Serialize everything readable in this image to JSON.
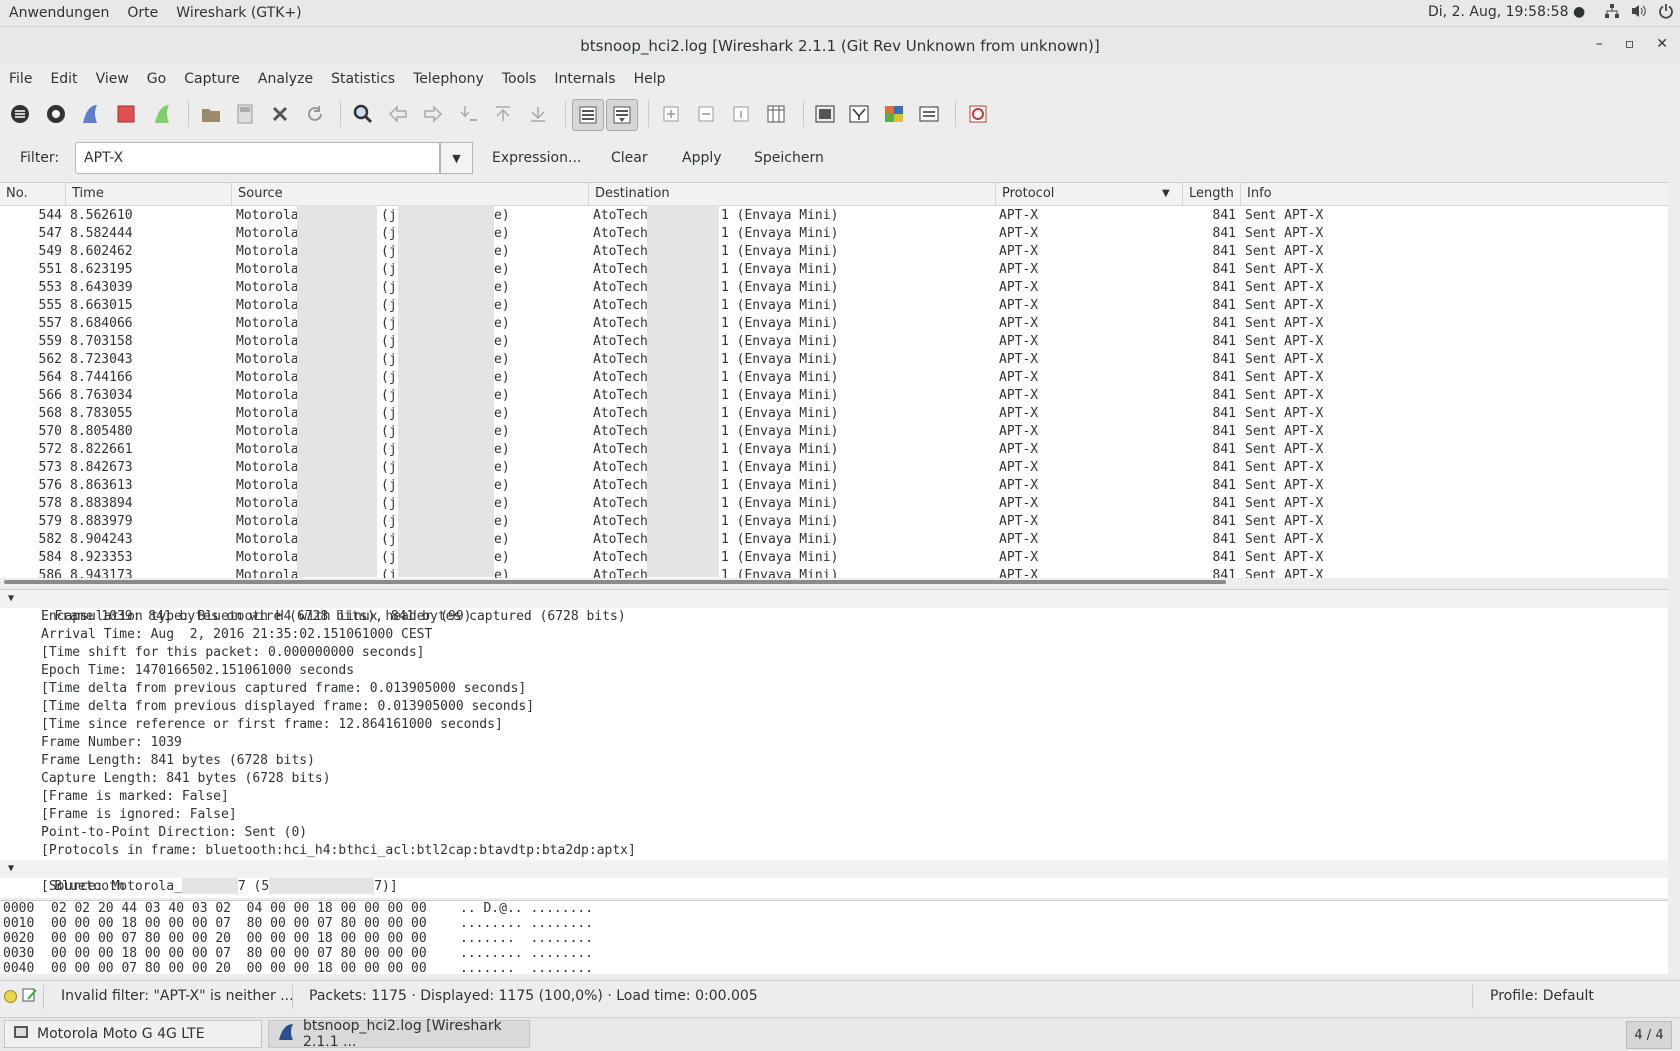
{
  "topbar": {
    "apps": "Anwendungen",
    "places": "Orte",
    "active_app": "Wireshark (GTK+)",
    "clock": "Di,  2. Aug, 19:58:58",
    "network_icon": "network-icon",
    "volume_icon": "volume-icon",
    "power_icon": "power-icon"
  },
  "window": {
    "title": "btsnoop_hci2.log [Wireshark 2.1.1 (Git Rev Unknown from unknown)]",
    "minimize": "–",
    "maximize": "▫",
    "close": "✕"
  },
  "menubar": [
    "File",
    "Edit",
    "View",
    "Go",
    "Capture",
    "Analyze",
    "Statistics",
    "Telephony",
    "Tools",
    "Internals",
    "Help"
  ],
  "toolbar": {
    "icons": [
      "interfaces-icon",
      "options-icon",
      "start-capture-icon",
      "stop-capture-icon",
      "restart-capture-icon",
      "open-file-icon",
      "save-file-icon",
      "close-file-icon",
      "reload-icon",
      "find-packet-icon",
      "go-back-icon",
      "go-forward-icon",
      "go-to-packet-icon",
      "go-first-icon",
      "go-last-icon",
      "colorize-icon",
      "autoscroll-icon",
      "zoom-in-icon",
      "zoom-out-icon",
      "normal-size-icon",
      "resize-columns-icon",
      "capture-filters-icon",
      "display-filters-icon",
      "coloring-rules-icon",
      "preferences-icon",
      "help-icon"
    ]
  },
  "filter": {
    "label": "Filter:",
    "value": "APT-X",
    "expression": "Expression...",
    "clear": "Clear",
    "apply": "Apply",
    "save": "Speichern"
  },
  "packet_list": {
    "columns": [
      "No.",
      "Time",
      "Source",
      "Destination",
      "Protocol",
      "Length",
      "Info"
    ],
    "rows": [
      {
        "no": "544",
        "time": "8.562610",
        "src_a": "Motorola",
        "src_b": "(j",
        "src_c": "e)",
        "dst_a": "AtoTech",
        "dst_b": "1 (Envaya Mini)",
        "proto": "APT-X",
        "len": "841",
        "info": "Sent APT-X"
      },
      {
        "no": "547",
        "time": "8.582444",
        "src_a": "Motorola",
        "src_b": "(j",
        "src_c": "e)",
        "dst_a": "AtoTech",
        "dst_b": "1 (Envaya Mini)",
        "proto": "APT-X",
        "len": "841",
        "info": "Sent APT-X"
      },
      {
        "no": "549",
        "time": "8.602462",
        "src_a": "Motorola",
        "src_b": "(j",
        "src_c": "e)",
        "dst_a": "AtoTech",
        "dst_b": "1 (Envaya Mini)",
        "proto": "APT-X",
        "len": "841",
        "info": "Sent APT-X"
      },
      {
        "no": "551",
        "time": "8.623195",
        "src_a": "Motorola",
        "src_b": "(j",
        "src_c": "e)",
        "dst_a": "AtoTech",
        "dst_b": "1 (Envaya Mini)",
        "proto": "APT-X",
        "len": "841",
        "info": "Sent APT-X"
      },
      {
        "no": "553",
        "time": "8.643039",
        "src_a": "Motorola",
        "src_b": "(j",
        "src_c": "e)",
        "dst_a": "AtoTech",
        "dst_b": "1 (Envaya Mini)",
        "proto": "APT-X",
        "len": "841",
        "info": "Sent APT-X"
      },
      {
        "no": "555",
        "time": "8.663015",
        "src_a": "Motorola",
        "src_b": "(j",
        "src_c": "e)",
        "dst_a": "AtoTech",
        "dst_b": "1 (Envaya Mini)",
        "proto": "APT-X",
        "len": "841",
        "info": "Sent APT-X"
      },
      {
        "no": "557",
        "time": "8.684066",
        "src_a": "Motorola",
        "src_b": "(j",
        "src_c": "e)",
        "dst_a": "AtoTech",
        "dst_b": "1 (Envaya Mini)",
        "proto": "APT-X",
        "len": "841",
        "info": "Sent APT-X"
      },
      {
        "no": "559",
        "time": "8.703158",
        "src_a": "Motorola",
        "src_b": "(j",
        "src_c": "e)",
        "dst_a": "AtoTech",
        "dst_b": "1 (Envaya Mini)",
        "proto": "APT-X",
        "len": "841",
        "info": "Sent APT-X"
      },
      {
        "no": "562",
        "time": "8.723043",
        "src_a": "Motorola",
        "src_b": "(j",
        "src_c": "e)",
        "dst_a": "AtoTech",
        "dst_b": "1 (Envaya Mini)",
        "proto": "APT-X",
        "len": "841",
        "info": "Sent APT-X"
      },
      {
        "no": "564",
        "time": "8.744166",
        "src_a": "Motorola",
        "src_b": "(j",
        "src_c": "e)",
        "dst_a": "AtoTech",
        "dst_b": "1 (Envaya Mini)",
        "proto": "APT-X",
        "len": "841",
        "info": "Sent APT-X"
      },
      {
        "no": "566",
        "time": "8.763034",
        "src_a": "Motorola",
        "src_b": "(j",
        "src_c": "e)",
        "dst_a": "AtoTech",
        "dst_b": "1 (Envaya Mini)",
        "proto": "APT-X",
        "len": "841",
        "info": "Sent APT-X"
      },
      {
        "no": "568",
        "time": "8.783055",
        "src_a": "Motorola",
        "src_b": "(j",
        "src_c": "e)",
        "dst_a": "AtoTech",
        "dst_b": "1 (Envaya Mini)",
        "proto": "APT-X",
        "len": "841",
        "info": "Sent APT-X"
      },
      {
        "no": "570",
        "time": "8.805480",
        "src_a": "Motorola",
        "src_b": "(j",
        "src_c": "e)",
        "dst_a": "AtoTech",
        "dst_b": "1 (Envaya Mini)",
        "proto": "APT-X",
        "len": "841",
        "info": "Sent APT-X"
      },
      {
        "no": "572",
        "time": "8.822661",
        "src_a": "Motorola",
        "src_b": "(j",
        "src_c": "e)",
        "dst_a": "AtoTech",
        "dst_b": "1 (Envaya Mini)",
        "proto": "APT-X",
        "len": "841",
        "info": "Sent APT-X"
      },
      {
        "no": "573",
        "time": "8.842673",
        "src_a": "Motorola",
        "src_b": "(j",
        "src_c": "e)",
        "dst_a": "AtoTech",
        "dst_b": "1 (Envaya Mini)",
        "proto": "APT-X",
        "len": "841",
        "info": "Sent APT-X"
      },
      {
        "no": "576",
        "time": "8.863613",
        "src_a": "Motorola",
        "src_b": "(j",
        "src_c": "e)",
        "dst_a": "AtoTech",
        "dst_b": "1 (Envaya Mini)",
        "proto": "APT-X",
        "len": "841",
        "info": "Sent APT-X"
      },
      {
        "no": "578",
        "time": "8.883894",
        "src_a": "Motorola",
        "src_b": "(j",
        "src_c": "e)",
        "dst_a": "AtoTech",
        "dst_b": "1 (Envaya Mini)",
        "proto": "APT-X",
        "len": "841",
        "info": "Sent APT-X"
      },
      {
        "no": "579",
        "time": "8.883979",
        "src_a": "Motorola",
        "src_b": "(j",
        "src_c": "e)",
        "dst_a": "AtoTech",
        "dst_b": "1 (Envaya Mini)",
        "proto": "APT-X",
        "len": "841",
        "info": "Sent APT-X"
      },
      {
        "no": "582",
        "time": "8.904243",
        "src_a": "Motorola",
        "src_b": "(j",
        "src_c": "e)",
        "dst_a": "AtoTech",
        "dst_b": "1 (Envaya Mini)",
        "proto": "APT-X",
        "len": "841",
        "info": "Sent APT-X"
      },
      {
        "no": "584",
        "time": "8.923353",
        "src_a": "Motorola",
        "src_b": "(j",
        "src_c": "e)",
        "dst_a": "AtoTech",
        "dst_b": "1 (Envaya Mini)",
        "proto": "APT-X",
        "len": "841",
        "info": "Sent APT-X"
      },
      {
        "no": "586",
        "time": "8.943173",
        "src_a": "Motorola",
        "src_b": "(j",
        "src_c": "e)",
        "dst_a": "AtoTech",
        "dst_b": "1 (Envaya Mini)",
        "proto": "APT-X",
        "len": "841",
        "info": "Sent APT-X"
      }
    ]
  },
  "details": {
    "frame_header": "Frame 1039: 841 bytes on wire (6728 bits), 841 bytes captured (6728 bits)",
    "frame_fields": [
      "Encapsulation type: Bluetooth H4 with linux header (99)",
      "Arrival Time: Aug  2, 2016 21:35:02.151061000 CEST",
      "[Time shift for this packet: 0.000000000 seconds]",
      "Epoch Time: 1470166502.151061000 seconds",
      "[Time delta from previous captured frame: 0.013905000 seconds]",
      "[Time delta from previous displayed frame: 0.013905000 seconds]",
      "[Time since reference or first frame: 12.864161000 seconds]",
      "Frame Number: 1039",
      "Frame Length: 841 bytes (6728 bits)",
      "Capture Length: 841 bytes (6728 bits)",
      "[Frame is marked: False]",
      "[Frame is ignored: False]",
      "Point-to-Point Direction: Sent (0)",
      "[Protocols in frame: bluetooth:hci_h4:bthci_acl:btl2cap:btavdtp:bta2dp:aptx]"
    ],
    "bt_header": "Bluetooth",
    "bt_source_a": "[Source: Motorola_",
    "bt_source_b": "7 (5",
    "bt_source_c": "7)]"
  },
  "bytes": [
    {
      "offset": "0000",
      "hex": "02 02 20 44 03 40 03 02  04 00 00 18 00 00 00 00",
      "ascii": ".. D.@.. ........"
    },
    {
      "offset": "0010",
      "hex": "00 00 00 18 00 00 00 07  80 00 00 07 80 00 00 00",
      "ascii": "........ ........"
    },
    {
      "offset": "0020",
      "hex": "00 00 00 07 80 00 00 20  00 00 00 18 00 00 00 00",
      "ascii": ".......  ........"
    },
    {
      "offset": "0030",
      "hex": "00 00 00 18 00 00 00 07  80 00 00 07 80 00 00 00",
      "ascii": "........ ........"
    },
    {
      "offset": "0040",
      "hex": "00 00 00 07 80 00 00 20  00 00 00 18 00 00 00 00",
      "ascii": ".......  ........"
    }
  ],
  "status": {
    "filter_msg": "Invalid filter: \"APT-X\" is neither ...",
    "packets": "Packets: 1175 · Displayed: 1175 (100,0%)  · Load time: 0:00.005",
    "profile": "Profile: Default"
  },
  "taskbar": {
    "task1": "Motorola Moto G 4G LTE",
    "task2": "btsnoop_hci2.log [Wireshark 2.1.1 ...",
    "workspace": "4 / 4"
  },
  "colors": {
    "accent_blue": "#2a4f8f",
    "stop_red": "#e05050"
  }
}
